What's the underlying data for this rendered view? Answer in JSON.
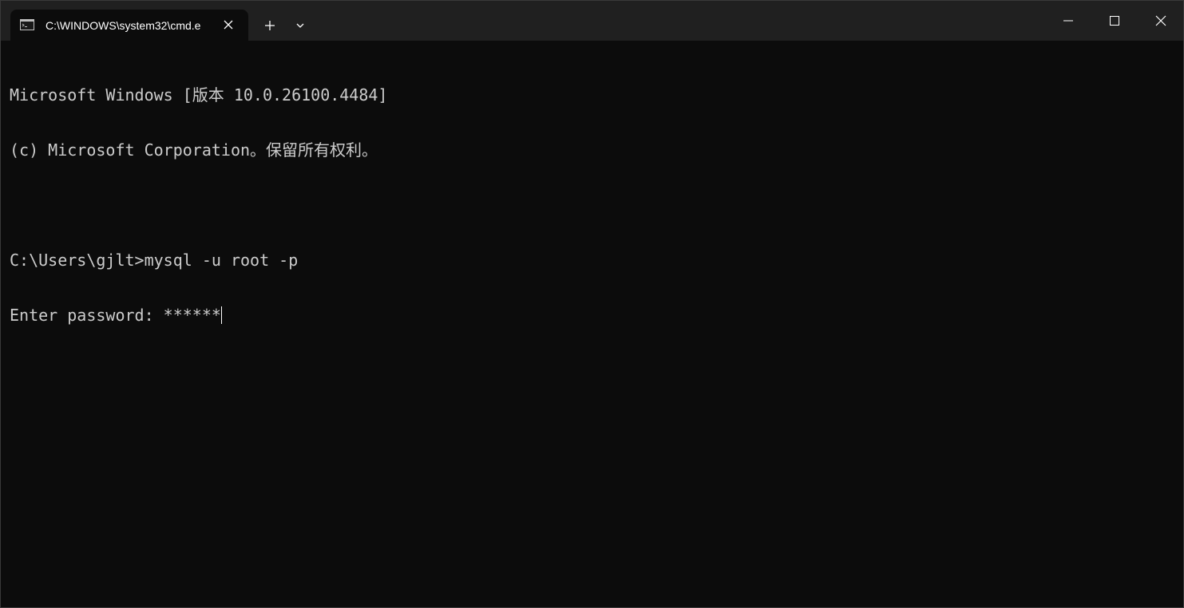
{
  "window": {
    "tab_title": "C:\\WINDOWS\\system32\\cmd.e",
    "tab_icon": "terminal-icon",
    "buttons": {
      "close_tab_icon": "close-icon",
      "new_tab_icon": "plus-icon",
      "dropdown_icon": "chevron-down-icon",
      "minimize_icon": "minimize-icon",
      "maximize_icon": "maximize-icon",
      "close_window_icon": "close-icon"
    }
  },
  "terminal": {
    "lines": [
      "Microsoft Windows [版本 10.0.26100.4484]",
      "(c) Microsoft Corporation。保留所有权利。",
      "",
      "C:\\Users\\gjlt>mysql -u root -p",
      "Enter password: ******"
    ]
  },
  "colors": {
    "background": "#0c0c0c",
    "titlebar": "#202020",
    "text": "#cccccc"
  }
}
